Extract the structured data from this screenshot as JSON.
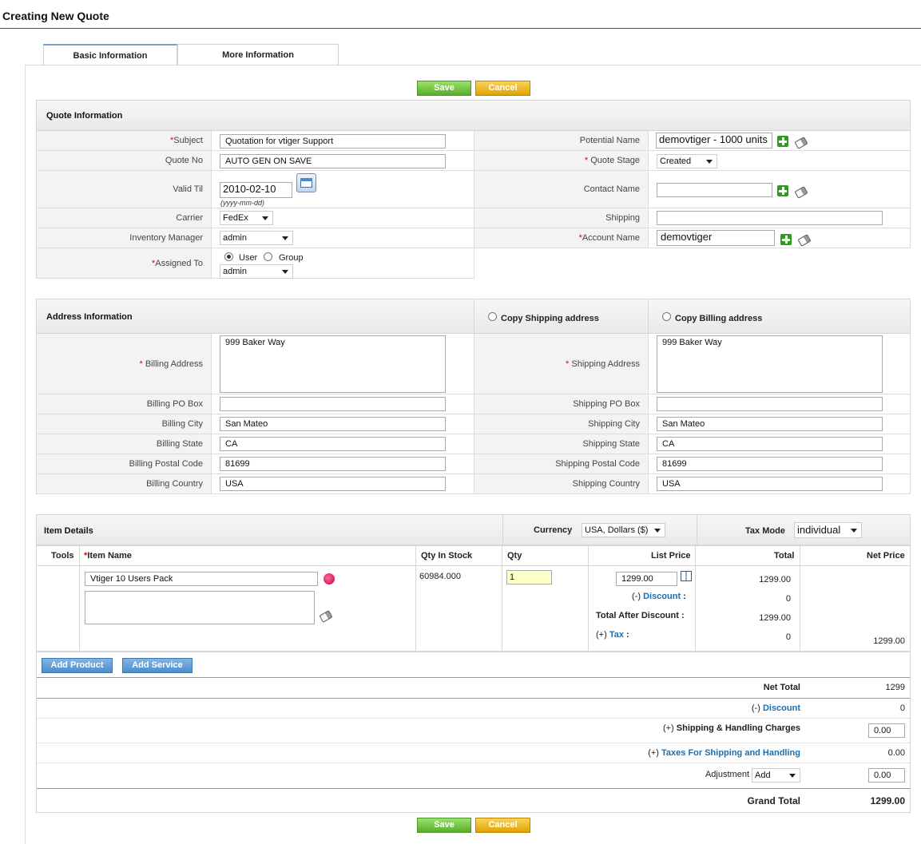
{
  "page": {
    "title": "Creating New Quote"
  },
  "tabs": [
    {
      "label": "Basic Information",
      "active": true
    },
    {
      "label": "More Information",
      "active": false
    }
  ],
  "buttons": {
    "save": "Save",
    "cancel": "Cancel"
  },
  "quote_info": {
    "header": "Quote Information",
    "subject": {
      "label": "Subject",
      "value": "Quotation for vtiger Support"
    },
    "quote_no": {
      "label": "Quote No",
      "value": "AUTO GEN ON SAVE"
    },
    "valid_till": {
      "label": "Valid Til",
      "value": "2010-02-10",
      "hint": "(yyyy-mm-dd)"
    },
    "carrier": {
      "label": "Carrier",
      "value": "FedEx"
    },
    "inventory_manager": {
      "label": "Inventory Manager",
      "value": "admin"
    },
    "assigned_to": {
      "label": "Assigned To",
      "user": "User",
      "group": "Group",
      "value": "admin"
    },
    "potential_name": {
      "label": "Potential Name",
      "value": "demovtiger - 1000 units"
    },
    "quote_stage": {
      "label": "Quote Stage",
      "value": "Created"
    },
    "contact_name": {
      "label": "Contact Name",
      "value": ""
    },
    "shipping": {
      "label": "Shipping",
      "value": ""
    },
    "account_name": {
      "label": "Account Name",
      "value": "demovtiger"
    }
  },
  "address": {
    "header": "Address Information",
    "copy_shipping": "Copy Shipping address",
    "copy_billing": "Copy Billing address",
    "billing_address": {
      "label": "Billing Address",
      "value": "999 Baker Way"
    },
    "shipping_address": {
      "label": "Shipping Address",
      "value": "999 Baker Way"
    },
    "billing_po": {
      "label": "Billing PO Box",
      "value": ""
    },
    "shipping_po": {
      "label": "Shipping PO Box",
      "value": ""
    },
    "billing_city": {
      "label": "Billing City",
      "value": "San Mateo"
    },
    "shipping_city": {
      "label": "Shipping City",
      "value": "San Mateo"
    },
    "billing_state": {
      "label": "Billing State",
      "value": "CA"
    },
    "shipping_state": {
      "label": "Shipping State",
      "value": "CA"
    },
    "billing_postal": {
      "label": "Billing Postal Code",
      "value": "81699"
    },
    "shipping_postal": {
      "label": "Shipping Postal Code",
      "value": "81699"
    },
    "billing_country": {
      "label": "Billing Country",
      "value": "USA"
    },
    "shipping_country": {
      "label": "Shipping Country",
      "value": "USA"
    }
  },
  "items": {
    "header": "Item Details",
    "currency_label": "Currency",
    "currency_value": "USA, Dollars ($)",
    "tax_mode_label": "Tax Mode",
    "tax_mode_value": "individual",
    "columns": {
      "tools": "Tools",
      "item_name": "Item Name",
      "qty_stock": "Qty In Stock",
      "qty": "Qty",
      "list_price": "List Price",
      "total": "Total",
      "net_price": "Net Price"
    },
    "row": {
      "item_name": "Vtiger 10 Users Pack",
      "description": "",
      "qty_stock": "60984.000",
      "qty": "1",
      "list_price": "1299.00",
      "discount_prefix": "(-)",
      "discount_label": "Discount",
      "total_after_discount_label": "Total After Discount :",
      "tax_prefix": "(+)",
      "tax_label": "Tax",
      "total": "1299.00",
      "discount_value": "0",
      "total_after_discount": "1299.00",
      "tax_value": "0",
      "net_price": "1299.00"
    },
    "add_product": "Add Product",
    "add_service": "Add Service"
  },
  "totals": {
    "net_total_label": "Net Total",
    "net_total": "1299",
    "discount_prefix": "(-)",
    "discount_label": "Discount",
    "discount": "0",
    "shipping_prefix": "(+)",
    "shipping_label": "Shipping & Handling Charges",
    "shipping": "0.00",
    "taxes_prefix": "(+)",
    "taxes_label": "Taxes For Shipping and Handling",
    "taxes": "0.00",
    "adjustment_label": "Adjustment",
    "adjustment_type": "Add",
    "adjustment": "0.00",
    "grand_total_label": "Grand Total",
    "grand_total": "1299.00"
  }
}
